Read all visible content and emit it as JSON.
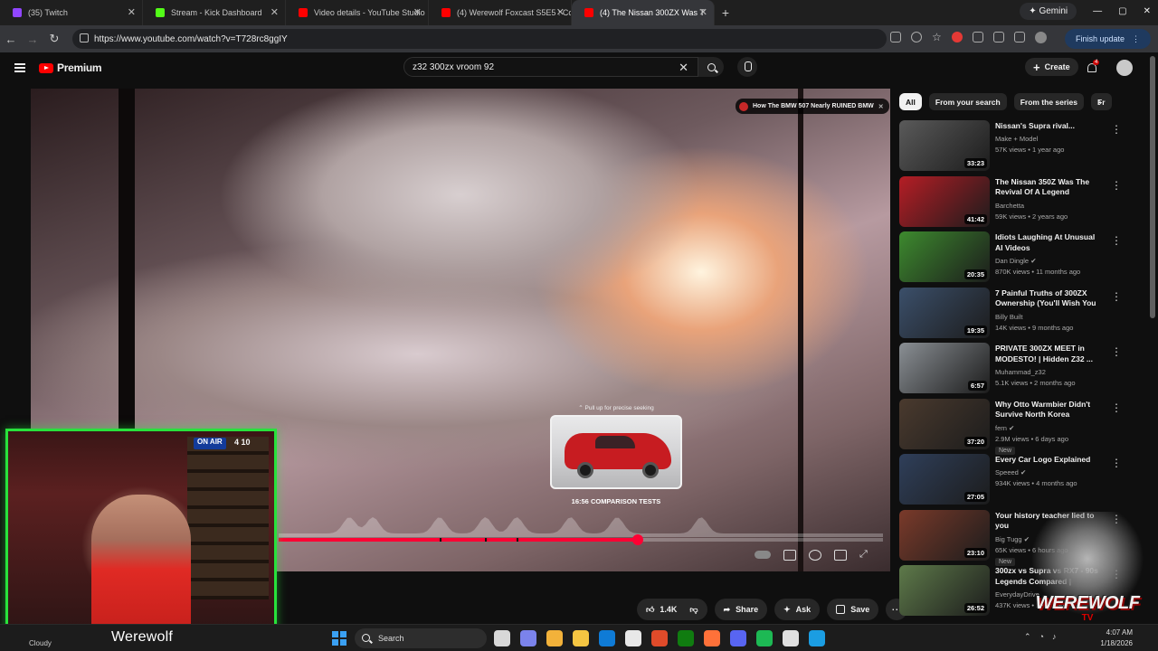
{
  "browser": {
    "tabs": [
      {
        "label": "(35) Twitch",
        "color": "#9146ff"
      },
      {
        "label": "Stream - Kick Dashboard",
        "color": "#53fc18"
      },
      {
        "label": "Video details - YouTube Studio",
        "color": "#ff0000"
      },
      {
        "label": "(4) Werewolf Foxcast S5E5 : Co",
        "color": "#ff0000"
      },
      {
        "label": "(4) The Nissan 300ZX Was T",
        "color": "#ff0000",
        "active": true
      }
    ],
    "gemini_label": "Gemini",
    "url": "https://www.youtube.com/watch?v=T728rc8ggIY",
    "finish_update_label": "Finish update"
  },
  "youtube": {
    "logo_label": "Premium",
    "search_value": "z32 300zx vroom  92",
    "create_label": "Create",
    "notification_count": "4"
  },
  "player": {
    "endcard_title": "How The BMW 507 Nearly RUINED BMW",
    "pull_tip": "⌃ Pull up for precise seeking",
    "chapter_label": "16:56  COMPARISON TESTS",
    "progress_fraction": 0.595,
    "hover_fraction": 0.558,
    "chapter_breaks": [
      0.266,
      0.342,
      0.394
    ],
    "heatmap_peaks": [
      0.117,
      0.156,
      0.266,
      0.342,
      0.394,
      0.483,
      0.56,
      0.699
    ]
  },
  "actions": {
    "like_count": "1.4K",
    "share_label": "Share",
    "ask_label": "Ask",
    "save_label": "Save"
  },
  "filters": {
    "chips": [
      "All",
      "From your search",
      "From the series",
      "Fr"
    ]
  },
  "recommendations": [
    {
      "title": "Nissan's Supra rival...",
      "channel": "Make + Model",
      "meta": "57K views • 1 year ago",
      "duration": "33:23",
      "thumb": "#5a5a5a",
      "verified": false,
      "new": false
    },
    {
      "title": "The Nissan 350Z Was The Revival Of A Legend",
      "channel": "Barchetta",
      "meta": "59K views • 2 years ago",
      "duration": "41:42",
      "thumb": "#b51d25",
      "verified": false,
      "new": false
    },
    {
      "title": "Idiots Laughing At Unusual AI Videos",
      "channel": "Dan Dingle",
      "meta": "870K views • 11 months ago",
      "duration": "20:35",
      "thumb": "#3d8a2e",
      "verified": true,
      "new": false
    },
    {
      "title": "7 Painful Truths of 300ZX Ownership (You'll Wish You ...",
      "channel": "Billy Built",
      "meta": "14K views • 9 months ago",
      "duration": "19:35",
      "thumb": "#3b4f6a",
      "verified": false,
      "new": false
    },
    {
      "title": "PRIVATE 300ZX MEET in MODESTO! | Hidden Z32 ...",
      "channel": "Muhammad_z32",
      "meta": "5.1K views • 2 months ago",
      "duration": "6:57",
      "thumb": "#8a8f94",
      "verified": false,
      "new": false
    },
    {
      "title": "Why Otto Warmbier Didn't Survive North Korea",
      "channel": "fern",
      "meta": "2.9M views • 6 days ago",
      "duration": "37:20",
      "thumb": "#4a3a2e",
      "verified": true,
      "new": true,
      "new_label": "New"
    },
    {
      "title": "Every Car Logo Explained",
      "channel": "Speeed",
      "meta": "934K views • 4 months ago",
      "duration": "27:05",
      "thumb": "#2f3f5a",
      "verified": true,
      "new": false
    },
    {
      "title": "Your history teacher lied to you",
      "channel": "Big Tugg",
      "meta": "65K views • 6 hours ago",
      "duration": "23:10",
      "thumb": "#7a3a2a",
      "verified": true,
      "new": true,
      "new_label": "New"
    },
    {
      "title": "300zx vs Supra vs RX7 - 90s Legends Compared | Everyday ...",
      "channel": "EverydayDrive",
      "meta": "437K views • 1 year ago",
      "duration": "26:52",
      "thumb": "#5e7a4a",
      "verified": false,
      "new": false
    }
  ],
  "overlay": {
    "webcam_name": "Werewolf",
    "onair_label": "ON AIR",
    "clock_text": "4 10",
    "brand_text": "WEREWOLF",
    "brand_sub": "TV"
  },
  "taskbar": {
    "weather": "Cloudy",
    "search_label": "Search",
    "time": "4:07 AM",
    "date": "1/18/2026",
    "app_colors": [
      "#d8d8d8",
      "#7b83eb",
      "#f3b23a",
      "#f5c542",
      "#0f7bd6",
      "#e8e8e8",
      "#e04b2a",
      "#107c10",
      "#ff7139",
      "#5865f2",
      "#1db954",
      "#e0e0e0",
      "#1b9de2"
    ]
  }
}
